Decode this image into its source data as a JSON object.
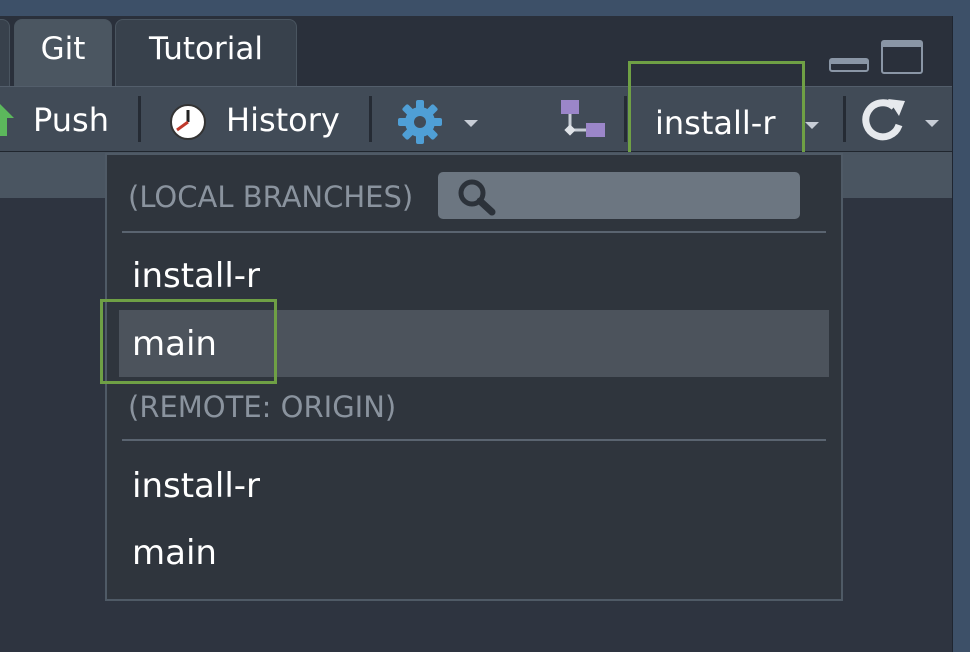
{
  "tabs": [
    {
      "label": "Git"
    },
    {
      "label": "Tutorial"
    }
  ],
  "toolbar": {
    "push_label": "Push",
    "history_label": "History",
    "branch_label": "install-r"
  },
  "dropdown": {
    "local_header": "(LOCAL BRANCHES)",
    "search_placeholder": "",
    "local_branches": [
      "install-r",
      "main"
    ],
    "selected_branch": "main",
    "remote_header": "(REMOTE: ORIGIN)",
    "remote_branches": [
      "install-r",
      "main"
    ]
  },
  "colors": {
    "highlight": "#6fa045",
    "push_arrow": "#5cb85c",
    "gear": "#4f9fd6",
    "branch_icon": "#9b86c9"
  },
  "icons": [
    "push-arrow-icon",
    "history-clock-icon",
    "gear-icon",
    "branch-icon",
    "refresh-icon",
    "search-icon"
  ]
}
